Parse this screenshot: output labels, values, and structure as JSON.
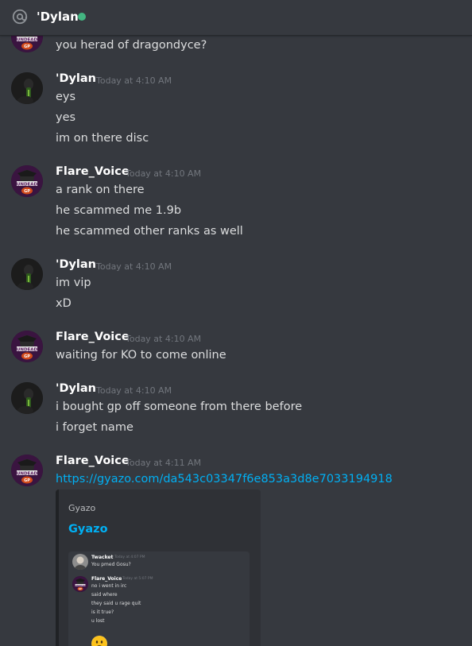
{
  "header": {
    "title": "'Dylan",
    "icon": "at-icon",
    "status_color": "#43b581"
  },
  "colors": {
    "background": "#36393f",
    "link": "#00b0f4",
    "timestamp": "#72767d"
  },
  "messages": [
    {
      "lines": [
        "you herad of dragondyce?"
      ]
    },
    {
      "author": "'Dylan",
      "timestamp": "Today at 4:10 AM",
      "lines": [
        "eys",
        "yes",
        "im on there disc"
      ]
    },
    {
      "author": "Flare_Voice",
      "timestamp": "Today at 4:10 AM",
      "lines": [
        "a rank on there",
        "he scammed me 1.9b",
        "he scammed other ranks as well"
      ]
    },
    {
      "author": "'Dylan",
      "timestamp": "Today at 4:10 AM",
      "lines": [
        "im vip",
        "xD"
      ]
    },
    {
      "author": "Flare_Voice",
      "timestamp": "Today at 4:10 AM",
      "lines": [
        "waiting for KO to come online"
      ]
    },
    {
      "author": "'Dylan",
      "timestamp": "Today at 4:10 AM",
      "lines": [
        "i bought gp off someone from there before",
        "i forget name"
      ]
    },
    {
      "author": "Flare_Voice",
      "timestamp": "Today at 4:11 AM",
      "link": "https://gyazo.com/da543c03347f6e853a3d8e7033194918",
      "embed": {
        "provider": "Gyazo",
        "title": "Gyazo",
        "screenshot": {
          "msg1": {
            "author": "Twacket",
            "timestamp": "Today at 4:07 PM",
            "lines": [
              "You pmed Gosu?"
            ]
          },
          "msg2": {
            "author": "Flare_Voice",
            "timestamp": "Today at 5:07 PM",
            "lines": [
              "no i went in irc",
              "said where",
              "they said u rage quit",
              "is it true?",
              "u lost"
            ]
          },
          "emoji": "frowning-face-emoji"
        }
      }
    }
  ]
}
